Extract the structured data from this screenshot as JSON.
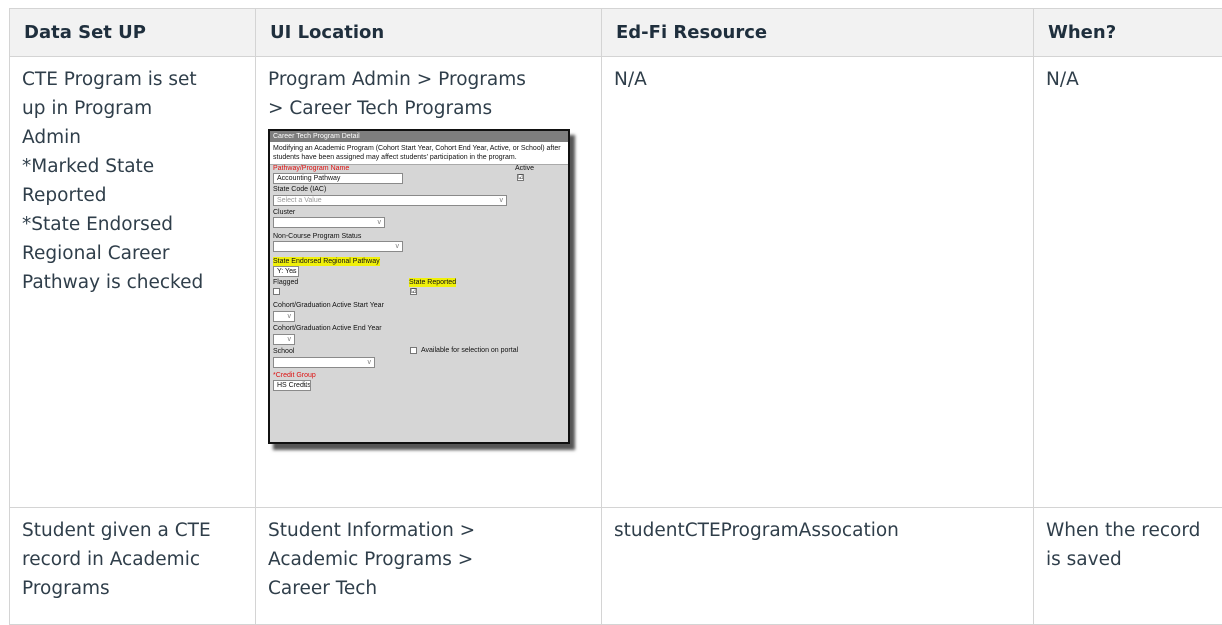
{
  "table": {
    "headers": [
      "Data Set UP",
      "UI Location",
      "Ed-Fi Resource",
      "When?"
    ],
    "rows": [
      {
        "setup_lines": [
          "CTE Program is set",
          "up in Program",
          "Admin",
          "*Marked State",
          "Reported",
          "*State Endorsed",
          "Regional Career",
          "Pathway is checked"
        ],
        "location_lines": [
          "Program Admin > Programs",
          "> Career Tech Programs"
        ],
        "resource": "N/A",
        "when": "N/A"
      },
      {
        "setup_lines": [
          "Student given a CTE",
          "record in Academic",
          "Programs"
        ],
        "location_lines": [
          "Student Information >",
          "Academic Programs >",
          "Career Tech"
        ],
        "resource": "studentCTEProgramAssocation",
        "when_lines": [
          "When the record",
          "is saved"
        ]
      }
    ]
  },
  "screenshot": {
    "title": "Career Tech Program Detail",
    "note": "Modifying an Academic Program (Cohort Start Year, Cohort End Year, Active, or School) after students have been assigned may affect students' participation in the program.",
    "pathway_label": "Pathway/Program Name",
    "pathway_value": "Accounting Pathway",
    "active_label": "Active",
    "state_code_label": "State Code (IAC)",
    "state_code_placeholder": "Select a Value",
    "cluster_label": "Cluster",
    "noncourse_label": "Non-Course Program Status",
    "endorsed_label": "State Endorsed Regional Pathway",
    "endorsed_value": "Y: Yes",
    "flagged_label": "Flagged",
    "state_reported_label": "State Reported",
    "cohort_start_label": "Cohort/Graduation Active Start Year",
    "cohort_end_label": "Cohort/Graduation Active End Year",
    "school_label": "School",
    "portal_label": "Available for selection on portal",
    "credit_group_label": "*Credit Group",
    "credit_group_value": "HS Credits",
    "check_mark": "☑",
    "chevron": "v"
  }
}
